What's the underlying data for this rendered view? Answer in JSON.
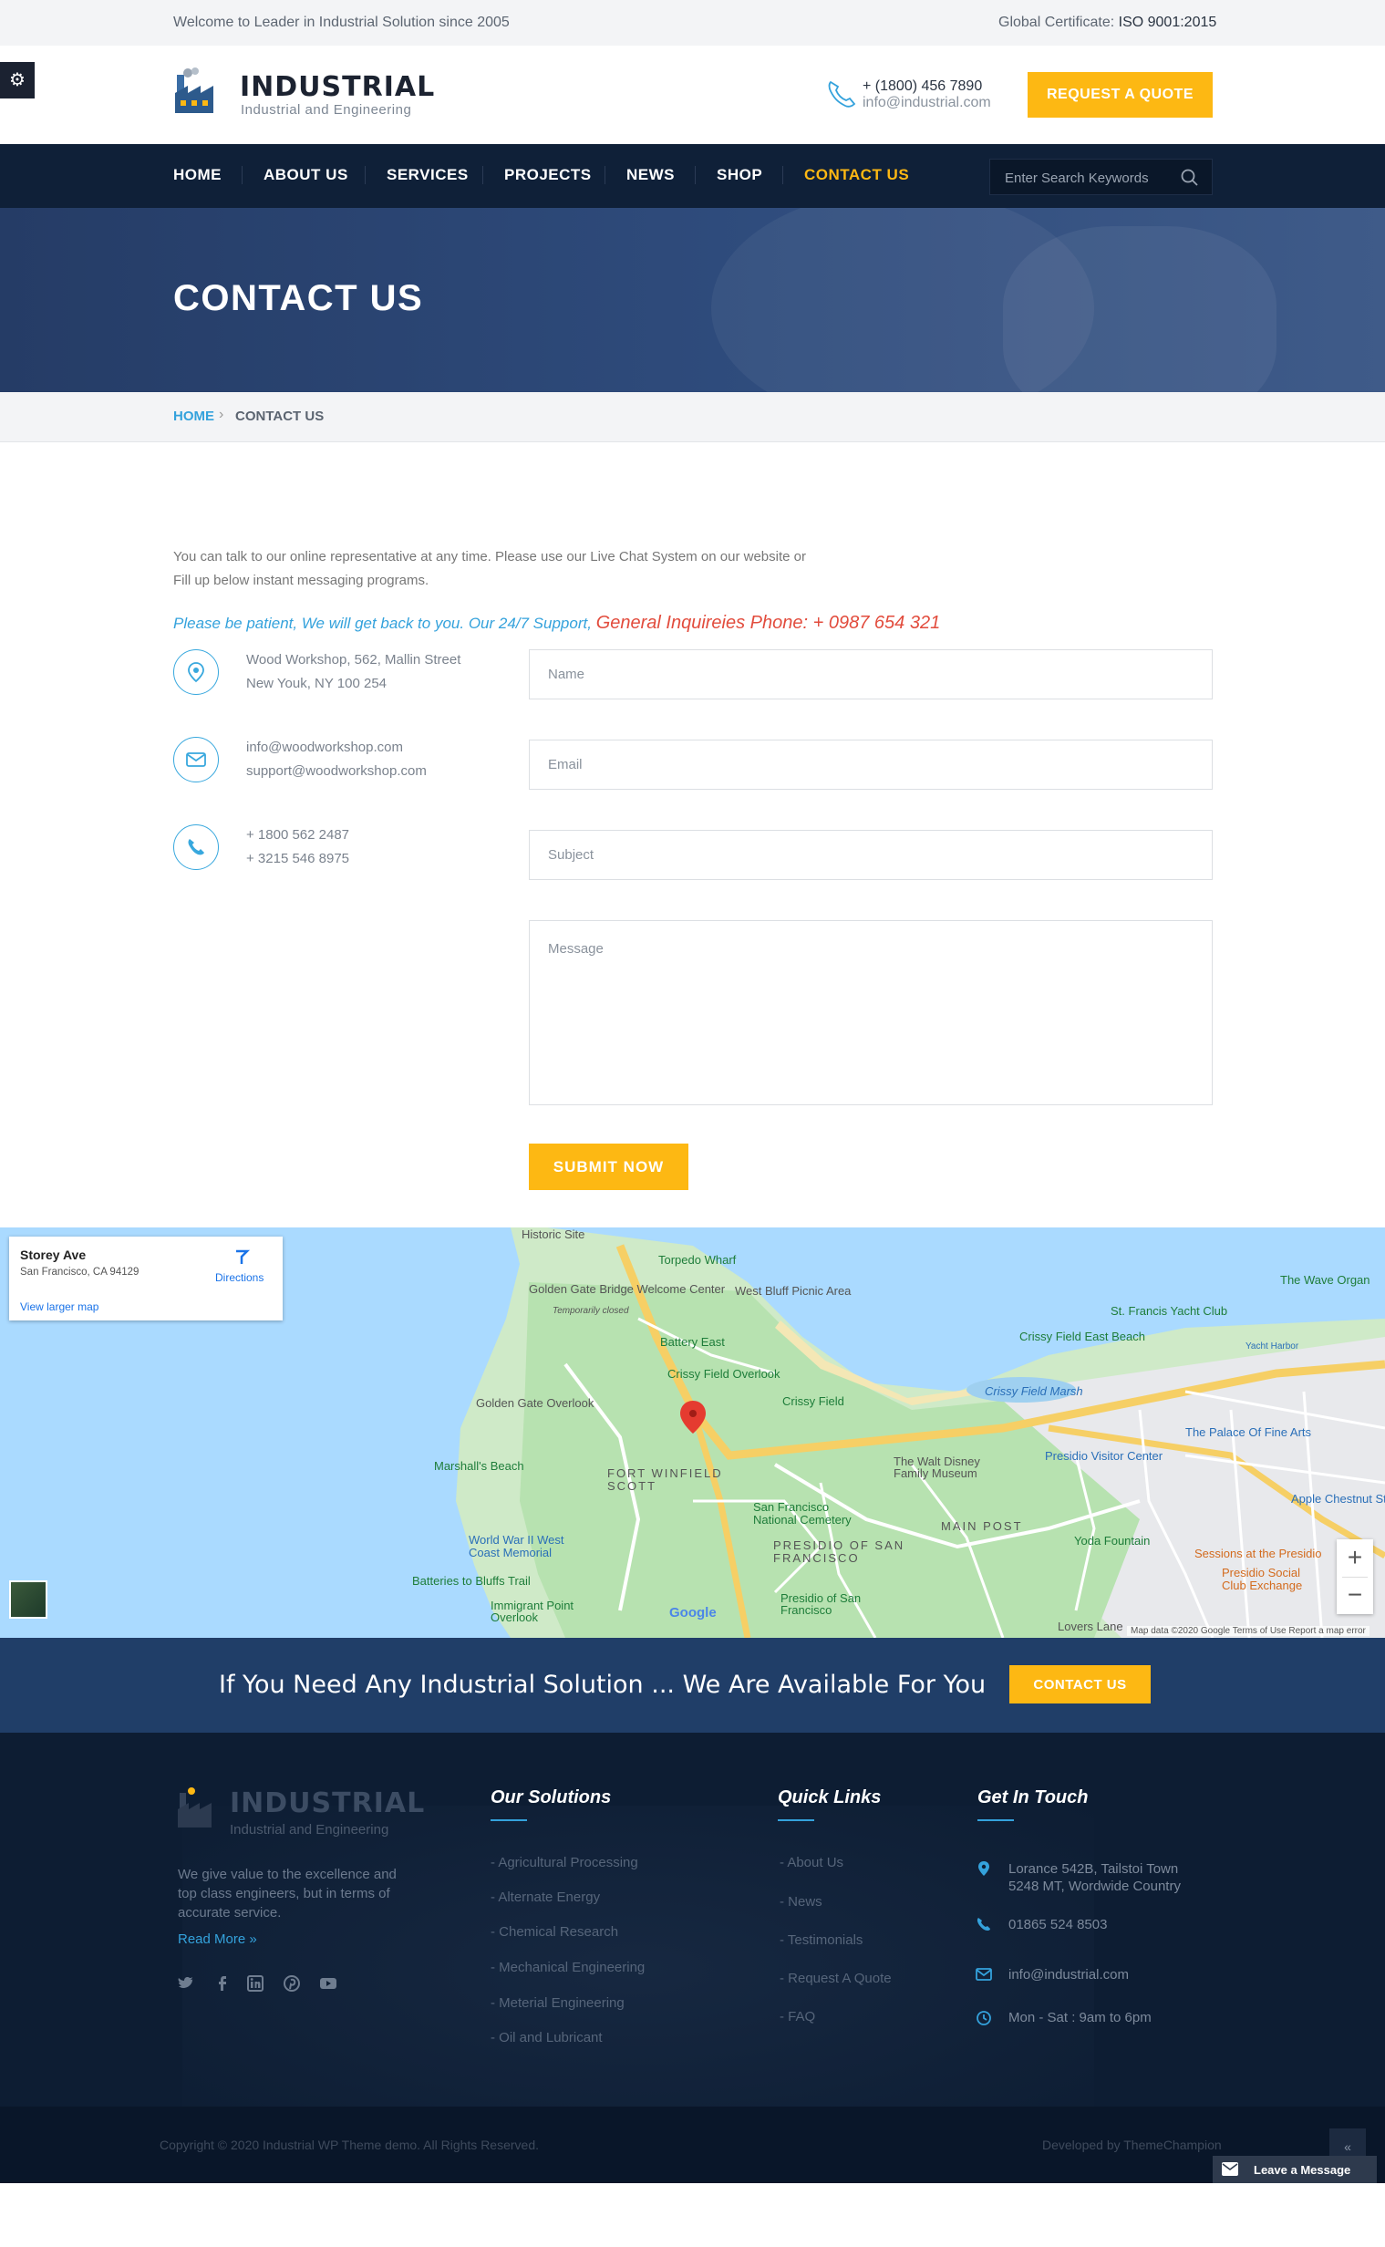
{
  "topbar": {
    "welcome": "Welcome to Leader in Industrial Solution since 2005",
    "cert_label": "Global Certificate:",
    "cert_value": "ISO 9001:2015"
  },
  "header": {
    "logo_title": "INDUSTRIAL",
    "logo_sub": "Industrial and Engineering",
    "phone": "+ (1800) 456 7890",
    "email": "info@industrial.com",
    "quote_button": "REQUEST A QUOTE"
  },
  "nav": {
    "items": [
      "HOME",
      "ABOUT US",
      "SERVICES",
      "PROJECTS",
      "NEWS",
      "SHOP",
      "CONTACT US"
    ],
    "active": "CONTACT US",
    "search_placeholder": "Enter Search Keywords"
  },
  "banner": {
    "title": "CONTACT US"
  },
  "breadcrumb": {
    "home": "HOME",
    "separator": "›",
    "current": "CONTACT US"
  },
  "intro": {
    "line1": "You can talk to our online representative at any time. Please use our Live Chat System on our website or",
    "line2": "Fill up below instant messaging programs.",
    "support": "Please be patient, We will get back to you. Our 24/7 Support,",
    "phone_line": "General Inquireies Phone: + 0987 654 321"
  },
  "contact_info": {
    "address1": "Wood Workshop, 562, Mallin Street",
    "address2": "New Youk, NY 100 254",
    "email1": "info@woodworkshop.com",
    "email2": "support@woodworkshop.com",
    "phone1": "+ 1800 562 2487",
    "phone2": "+ 3215 546 8975"
  },
  "form": {
    "name_placeholder": "Name",
    "email_placeholder": "Email",
    "subject_placeholder": "Subject",
    "message_placeholder": "Message",
    "submit": "SUBMIT NOW"
  },
  "map": {
    "card_title": "Storey Ave",
    "card_address": "San Francisco, CA 94129",
    "card_link": "View larger map",
    "directions": "Directions",
    "google": "Google",
    "attribution": "Map data ©2020 Google   Terms of Use   Report a map error",
    "labels": [
      "Historic Site",
      "Torpedo Wharf",
      "Golden Gate Bridge Welcome Center",
      "Temporarily closed",
      "West Bluff Picnic Area",
      "Battery East",
      "Crissy Field Overlook",
      "Golden Gate Overlook",
      "Crissy Field",
      "Crissy Field Marsh",
      "Marshall's Beach",
      "FORT WINFIELD SCOTT",
      "The Walt Disney Family Museum",
      "Presidio Visitor Center",
      "San Francisco National Cemetery",
      "World War II West Coast Memorial",
      "PRESIDIO OF SAN FRANCISCO",
      "MAIN POST",
      "Yoda Fountain",
      "Batteries to Bluffs Trail",
      "Immigrant Point Overlook",
      "Presidio of San Francisco",
      "The Wave Organ",
      "St. Francis Yacht Club",
      "Crissy Field East Beach",
      "Yacht Harbor",
      "The Palace Of Fine Arts",
      "Apple Chestnut St",
      "Sessions at the Presidio",
      "Presidio Social Club Exchange",
      "Lovers Lane"
    ]
  },
  "cta": {
    "text": "If You Need Any Industrial Solution ... We Are Available For You",
    "button": "CONTACT US"
  },
  "footer": {
    "logo_title": "INDUSTRIAL",
    "logo_sub": "Industrial and Engineering",
    "about": "We give value to the excellence and top class engineers, but in terms of accurate service.",
    "read_more": "Read More »",
    "solutions_heading": "Our Solutions",
    "solutions": [
      "- Agricultural Processing",
      "- Alternate Energy",
      "- Chemical Research",
      "- Mechanical Engineering",
      "- Meterial Engineering",
      "- Oil and Lubricant"
    ],
    "quick_heading": "Quick Links",
    "quick_links": [
      "- About Us",
      "- News",
      "- Testimonials",
      "- Request A Quote",
      "- FAQ"
    ],
    "touch_heading": "Get In Touch",
    "address1": "Lorance 542B, Tailstoi Town",
    "address2": "5248 MT, Wordwide Country",
    "phone": "01865 524 8503",
    "email": "info@industrial.com",
    "hours": "Mon - Sat : 9am to 6pm"
  },
  "bottom": {
    "copyright": "Copyright © 2020 Industrial WP Theme demo. All Rights Reserved.",
    "developed": "Developed by ThemeChampion",
    "leave_message": "Leave a Message",
    "to_top": "«"
  },
  "colors": {
    "accent": "#fdb813",
    "nav_bg": "#0f2038",
    "link_blue": "#34a2dc",
    "support_red": "#e24c3d"
  }
}
